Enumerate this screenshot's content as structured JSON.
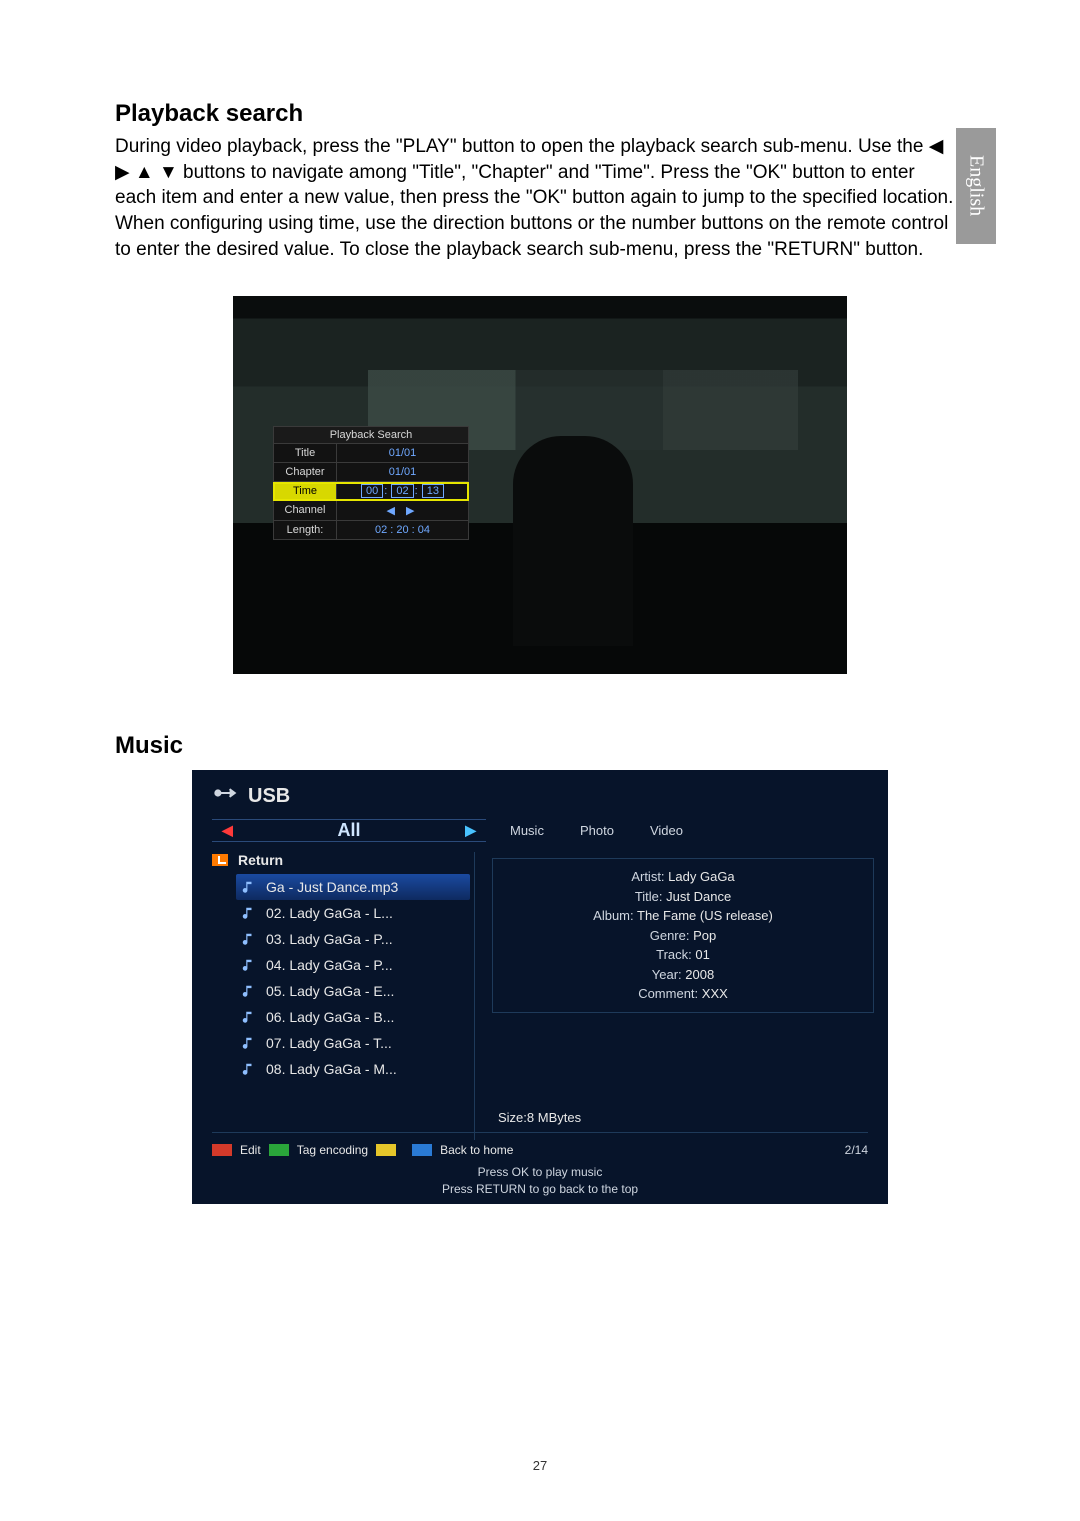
{
  "lang_tab": "English",
  "page_number": "27",
  "sec1": {
    "heading": "Playback search",
    "body": "During video playback, press the \"PLAY\" button to open the playback search sub-menu. Use the ◀ ▶ ▲ ▼ buttons to navigate among \"Title\", \"Chapter\" and \"Time\". Press the \"OK\" button to enter each item and enter a new value, then press the \"OK\" button again to jump to the specified location. When configuring using time, use the direction buttons or the number buttons on the remote control to enter the desired value. To close the playback search sub-menu, press the \"RETURN\" button."
  },
  "playback_panel": {
    "title": "Playback Search",
    "rows": {
      "title": {
        "label": "Title",
        "value": "01/01"
      },
      "chapter": {
        "label": "Chapter",
        "value": "01/01"
      },
      "time": {
        "label": "Time",
        "hh": "00",
        "mm": "02",
        "ss": "13"
      },
      "channel": {
        "label": "Channel",
        "value": "◀ ▶"
      },
      "length": {
        "label": "Length:",
        "value": "02 : 20 : 04"
      }
    }
  },
  "sec2": {
    "heading": "Music"
  },
  "usb": {
    "device": "USB",
    "tab_all": "All",
    "tabs": [
      "Music",
      "Photo",
      "Video"
    ],
    "return": "Return",
    "tracks": [
      "Ga - Just Dance.mp3",
      "02. Lady GaGa - L...",
      "03. Lady GaGa - P...",
      "04. Lady GaGa - P...",
      "05. Lady GaGa - E...",
      "06. Lady GaGa - B...",
      "07. Lady GaGa - T...",
      "08. Lady GaGa - M..."
    ],
    "selected_index": 0,
    "info": {
      "Artist": "Lady GaGa",
      "Title": "Just Dance",
      "Album": "The Fame (US release)",
      "Genre": "Pop",
      "Track": "01",
      "Year": "2008",
      "Comment": "XXX"
    },
    "size": "Size:8 MBytes",
    "legend": {
      "red": "Edit",
      "green": "Tag encoding",
      "yellow": "",
      "blue": "Back to home"
    },
    "counter": "2/14",
    "hint1": "Press OK to play music",
    "hint2": "Press RETURN to go back to the top"
  }
}
